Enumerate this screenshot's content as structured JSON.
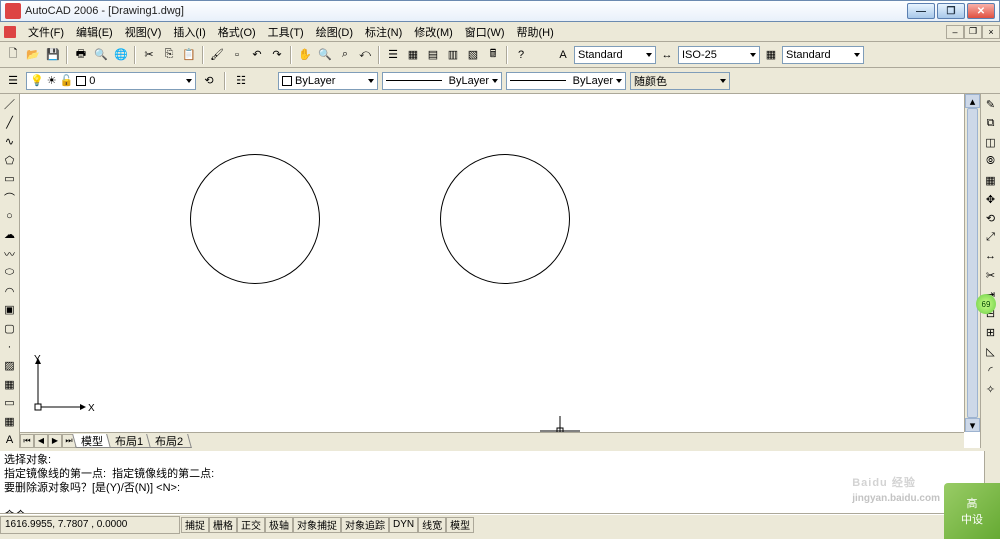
{
  "window": {
    "title": "AutoCAD 2006 - [Drawing1.dwg]"
  },
  "menu": [
    "文件(F)",
    "编辑(E)",
    "视图(V)",
    "插入(I)",
    "格式(O)",
    "工具(T)",
    "绘图(D)",
    "标注(N)",
    "修改(M)",
    "窗口(W)",
    "帮助(H)"
  ],
  "style_dropdowns": {
    "text_style": "Standard",
    "dim_style": "ISO-25",
    "table_style": "Standard"
  },
  "layer": {
    "current": "0"
  },
  "props": {
    "color_label": "ByLayer",
    "linetype": "ByLayer",
    "lineweight": "ByLayer",
    "plotstyle": "随颜色"
  },
  "tabs": [
    "模型",
    "布局1",
    "布局2"
  ],
  "ucs": {
    "x": "X",
    "y": "Y"
  },
  "cmd": {
    "line1": "选择对象:",
    "line2": "指定镜像线的第一点:  指定镜像线的第二点:",
    "line3": "要删除源对象吗？[是(Y)/否(N)] <N>:",
    "prompt": "命令:"
  },
  "status": {
    "coords": "1616.9955, 7.7807   , 0.0000",
    "toggles": [
      "捕捉",
      "栅格",
      "正交",
      "极轴",
      "对象捕捉",
      "对象追踪",
      "DYN",
      "线宽",
      "模型"
    ]
  },
  "watermark": {
    "main": "Baidu 经验",
    "sub": "jingyan.baidu.com"
  },
  "badge": {
    "l1": "高",
    "l2": "中设"
  },
  "side_badge": "69"
}
